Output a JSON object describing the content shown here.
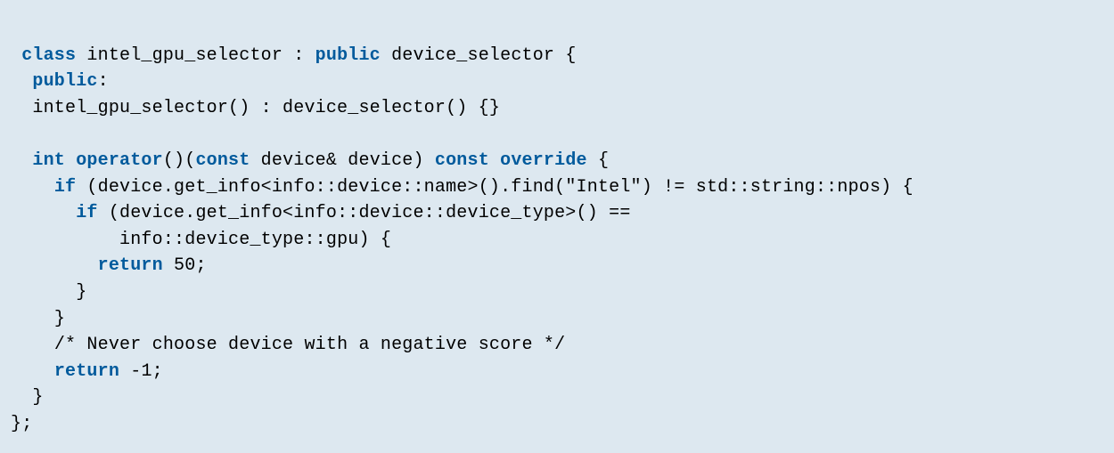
{
  "code": {
    "l1": {
      "kw_class": "class",
      "t1": " intel_gpu_selector : ",
      "kw_public": "public",
      "t2": " device_selector {"
    },
    "l2": {
      "kw_public": "public",
      "t1": ":"
    },
    "l3": {
      "t1": "intel_gpu_selector() : device_selector() {}"
    },
    "l4": {
      "t1": ""
    },
    "l5": {
      "kw_int": "int",
      "sp1": " ",
      "kw_operator": "operator",
      "t1": "()(",
      "kw_const1": "const",
      "t2": " device& device) ",
      "kw_const2": "const",
      "sp2": " ",
      "kw_override": "override",
      "t3": " {"
    },
    "l6": {
      "kw_if": "if",
      "t1": " (device.get_info<info::device::name>().find(",
      "str": "\"Intel\"",
      "t2": ") != std::string::npos) {"
    },
    "l7": {
      "kw_if": "if",
      "t1": " (device.get_info<info::device::device_type>() =="
    },
    "l8": {
      "t1": "info::device_type::gpu) {"
    },
    "l9": {
      "kw_return": "return",
      "sp": " ",
      "num": "50",
      "t1": ";"
    },
    "l10": {
      "t1": "}"
    },
    "l11": {
      "t1": "}"
    },
    "l12": {
      "cmt": "/* Never choose device with a negative score */"
    },
    "l13": {
      "kw_return": "return",
      "t1": " -",
      "num": "1",
      "t2": ";"
    },
    "l14": {
      "t1": "}"
    },
    "l15": {
      "t1": "};"
    }
  }
}
